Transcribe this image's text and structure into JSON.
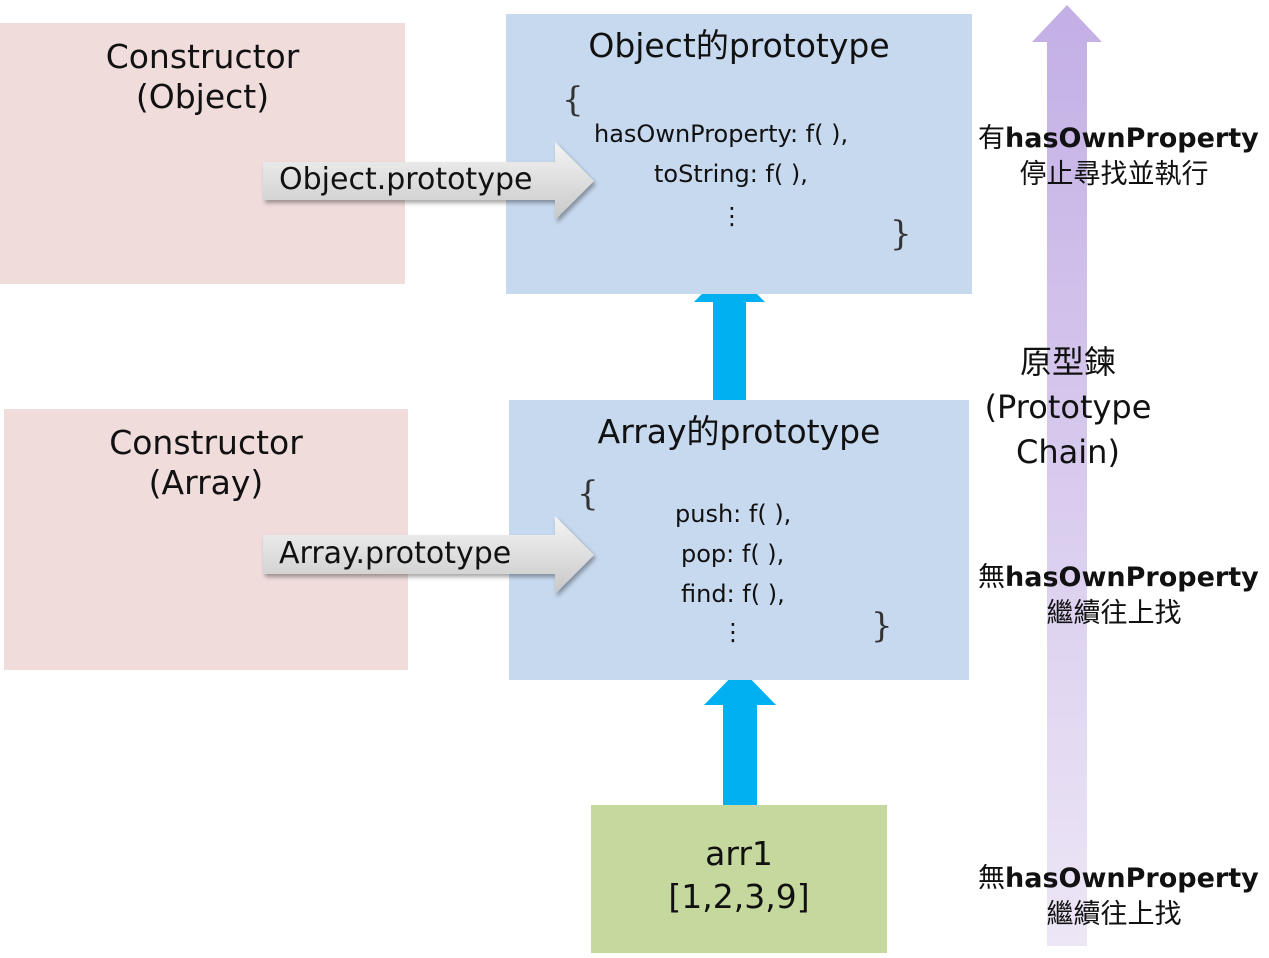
{
  "colors": {
    "constructor_bg": "#f1dcdc",
    "prototype_bg": "#c7d9ef",
    "instance_bg": "#c5d89e",
    "up_arrow": "#00b0f0",
    "chain_arrow": "#cdbbe8",
    "gray_arrow": "#d4d4d4"
  },
  "constructor_object": {
    "line1": "Constructor",
    "line2": "(Object)"
  },
  "constructor_array": {
    "line1": "Constructor",
    "line2": "(Array)"
  },
  "object_prototype": {
    "title": "Object的prototype",
    "open_brace": "{",
    "close_brace": "}",
    "props": [
      "hasOwnProperty: f( ),",
      "toString: f( ),"
    ],
    "ellipsis": "⋮"
  },
  "array_prototype": {
    "title": "Array的prototype",
    "open_brace": "{",
    "close_brace": "}",
    "props": [
      "push: f( ),",
      "pop: f( ),",
      "find: f( ),"
    ],
    "ellipsis": "⋮"
  },
  "instance": {
    "name": "arr1",
    "value": "[1,2,3,9]"
  },
  "links": {
    "object_prototype_label": "Object.prototype",
    "array_prototype_label": "Array.prototype"
  },
  "chain": {
    "top_note_prefix": "有",
    "top_note_keyword": "hasOwnProperty",
    "top_note_line2": "停止尋找並執行",
    "title_line1": "原型鍊",
    "title_line2": "(Prototype",
    "title_line3": "Chain)",
    "mid_note_prefix": "無",
    "mid_note_keyword": "hasOwnProperty",
    "mid_note_line2": "繼續往上找",
    "bottom_note_prefix": "無",
    "bottom_note_keyword": "hasOwnProperty",
    "bottom_note_line2": "繼續往上找"
  }
}
